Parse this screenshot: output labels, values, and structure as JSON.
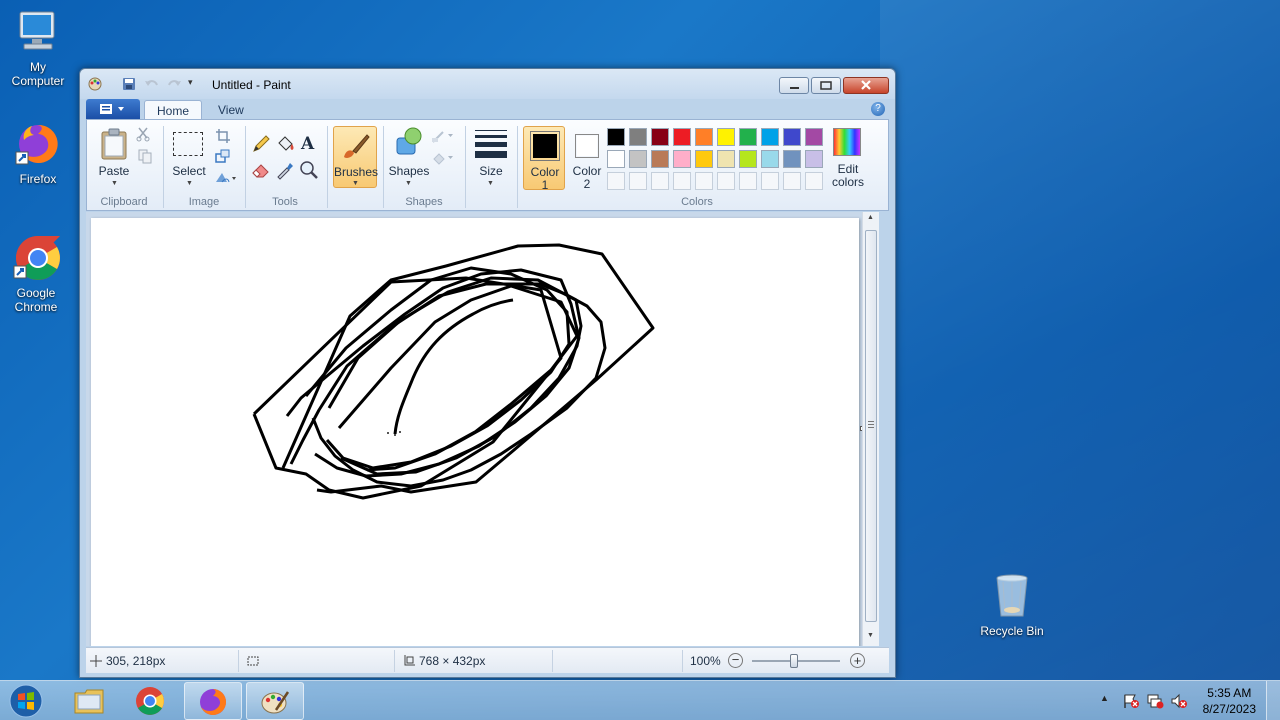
{
  "desktop": {
    "icons": [
      {
        "label_line1": "My",
        "label_line2": "Computer",
        "icon": "computer-icon"
      },
      {
        "label_line1": "Firefox",
        "label_line2": "",
        "icon": "firefox-icon"
      },
      {
        "label_line1": "Google",
        "label_line2": "Chrome",
        "icon": "chrome-icon"
      },
      {
        "label_line1": "Recycle Bin",
        "label_line2": "",
        "icon": "recycle-bin-icon"
      }
    ]
  },
  "window": {
    "title": "Untitled - Paint"
  },
  "ribbon": {
    "tabs": [
      {
        "label": "Home",
        "active": true
      },
      {
        "label": "View",
        "active": false
      }
    ],
    "clipboard": {
      "paste": "Paste",
      "group": "Clipboard"
    },
    "image": {
      "select": "Select",
      "group": "Image"
    },
    "tools": {
      "group": "Tools",
      "text_tool": "A"
    },
    "brushes": {
      "label": "Brushes"
    },
    "shapes": {
      "label": "Shapes",
      "group": "Shapes"
    },
    "size": {
      "label": "Size"
    },
    "color1": {
      "label_line1": "Color",
      "label_line2": "1",
      "value": "#000000"
    },
    "color2": {
      "label_line1": "Color",
      "label_line2": "2",
      "value": "#ffffff"
    },
    "colors_group": "Colors",
    "edit_colors": {
      "label_line1": "Edit",
      "label_line2": "colors"
    },
    "palette_row1": [
      "#000000",
      "#7f7f7f",
      "#880015",
      "#ed1c24",
      "#ff7f27",
      "#fff200",
      "#22b14c",
      "#00a2e8",
      "#3f48cc",
      "#a349a4"
    ],
    "palette_row2": [
      "#ffffff",
      "#c3c3c3",
      "#b97a57",
      "#ffaec9",
      "#ffc90e",
      "#efe4b0",
      "#b5e61d",
      "#99d9ea",
      "#7092be",
      "#c8bfe7"
    ]
  },
  "status": {
    "cursor_pos": "305, 218px",
    "canvas_size": "768 × 432px",
    "zoom": "100%",
    "zoom_level": 1.0
  },
  "taskbar": {
    "time": "5:35 AM",
    "date": "8/27/2023",
    "apps": [
      {
        "icon": "file-explorer-icon",
        "open": false
      },
      {
        "icon": "chrome-icon",
        "open": false
      },
      {
        "icon": "firefox-icon",
        "open": true
      },
      {
        "icon": "paint-icon",
        "open": true
      }
    ]
  }
}
